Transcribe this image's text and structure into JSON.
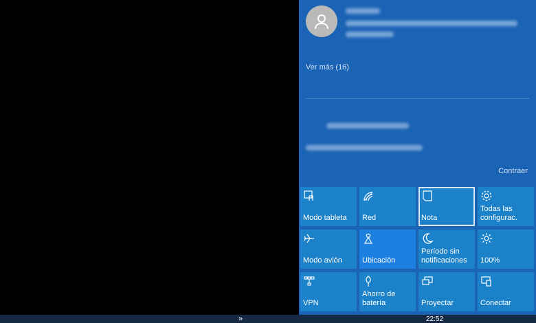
{
  "notifications": {
    "see_more": "Ver más (16)",
    "collapse": "Contraer"
  },
  "quick_actions": [
    {
      "label": "Modo tableta",
      "icon": "tablet-mode-icon"
    },
    {
      "label": "Red",
      "icon": "network-icon"
    },
    {
      "label": "Nota",
      "icon": "note-icon"
    },
    {
      "label": "Todas las configurac.",
      "icon": "settings-gear-icon"
    },
    {
      "label": "Modo avión",
      "icon": "airplane-icon"
    },
    {
      "label": "Ubicación",
      "icon": "location-icon"
    },
    {
      "label": "Período sin notificaciones",
      "icon": "moon-icon"
    },
    {
      "label": "100%",
      "icon": "brightness-icon"
    },
    {
      "label": "VPN",
      "icon": "vpn-icon"
    },
    {
      "label": "Ahorro de batería",
      "icon": "battery-saver-icon"
    },
    {
      "label": "Proyectar",
      "icon": "project-icon"
    },
    {
      "label": "Conectar",
      "icon": "connect-icon"
    }
  ],
  "taskbar": {
    "overflow": "»",
    "time": "22:52"
  },
  "colors": {
    "panel": "#1b63b4",
    "tile": "#1b82c9",
    "tile_active": "#1d7fe0",
    "taskbar": "#162a46"
  }
}
